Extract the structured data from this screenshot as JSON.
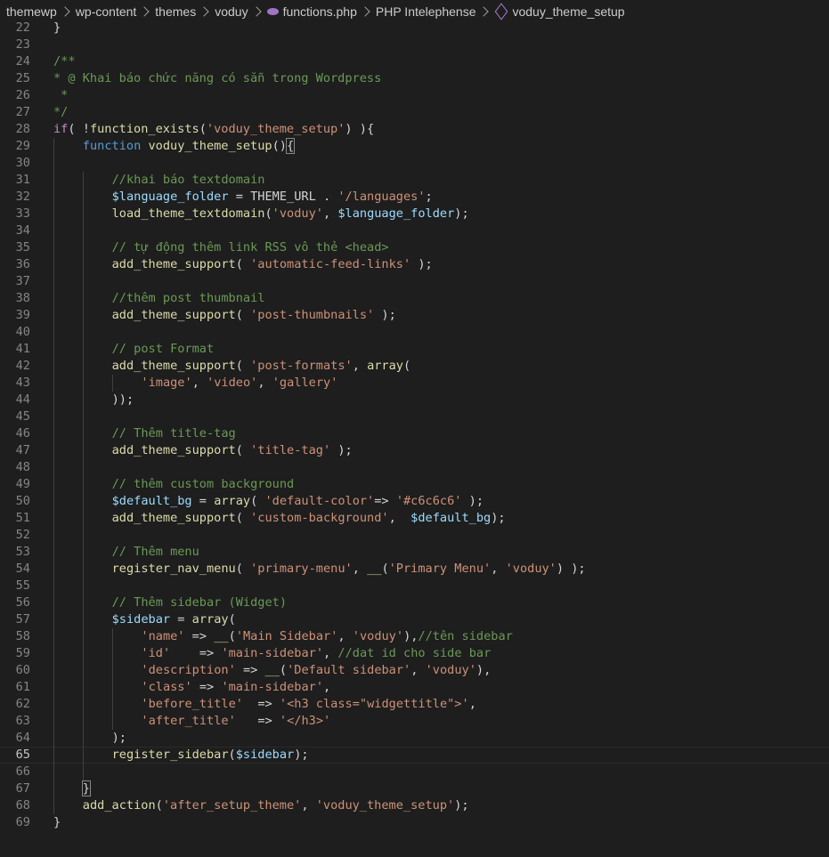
{
  "breadcrumb": {
    "items": [
      "themewp",
      "wp-content",
      "themes",
      "voduy",
      "functions.php",
      "PHP Intelephense",
      "voduy_theme_setup"
    ]
  },
  "editor": {
    "current_line": 65,
    "lines": [
      {
        "n": 22,
        "i": 0,
        "t": [
          [
            "p",
            "}"
          ]
        ]
      },
      {
        "n": 23,
        "i": 0,
        "t": []
      },
      {
        "n": 24,
        "i": 0,
        "t": [
          [
            "c",
            "/**"
          ]
        ]
      },
      {
        "n": 25,
        "i": 0,
        "t": [
          [
            "c",
            "* @ Khai báo chức năng có sẵn trong Wordpress"
          ]
        ]
      },
      {
        "n": 26,
        "i": 0,
        "t": [
          [
            "c",
            " *"
          ]
        ]
      },
      {
        "n": 27,
        "i": 0,
        "t": [
          [
            "c",
            "*/"
          ]
        ]
      },
      {
        "n": 28,
        "i": 0,
        "t": [
          [
            "k",
            "if"
          ],
          [
            "p",
            "( !"
          ],
          [
            "f",
            "function_exists"
          ],
          [
            "p",
            "("
          ],
          [
            "s",
            "'voduy_theme_setup'"
          ],
          [
            "p",
            ") ){"
          ]
        ]
      },
      {
        "n": 29,
        "i": 1,
        "t": [
          [
            "kb",
            "function"
          ],
          [
            "p",
            " "
          ],
          [
            "f",
            "voduy_theme_setup"
          ],
          [
            "p",
            "()"
          ],
          [
            "cur",
            "{"
          ]
        ]
      },
      {
        "n": 30,
        "i": 1,
        "t": []
      },
      {
        "n": 31,
        "i": 2,
        "t": [
          [
            "c",
            "//khai báo textdomain"
          ]
        ]
      },
      {
        "n": 32,
        "i": 2,
        "t": [
          [
            "v",
            "$language_folder"
          ],
          [
            "p",
            " = THEME_URL . "
          ],
          [
            "s",
            "'/languages'"
          ],
          [
            "p",
            ";"
          ]
        ]
      },
      {
        "n": 33,
        "i": 2,
        "t": [
          [
            "f",
            "load_theme_textdomain"
          ],
          [
            "p",
            "("
          ],
          [
            "s",
            "'voduy'"
          ],
          [
            "p",
            ", "
          ],
          [
            "v",
            "$language_folder"
          ],
          [
            "p",
            ");"
          ]
        ]
      },
      {
        "n": 34,
        "i": 2,
        "t": []
      },
      {
        "n": 35,
        "i": 2,
        "t": [
          [
            "c",
            "// tự động thêm link RSS vô thẻ <head>"
          ]
        ]
      },
      {
        "n": 36,
        "i": 2,
        "t": [
          [
            "f",
            "add_theme_support"
          ],
          [
            "p",
            "( "
          ],
          [
            "s",
            "'automatic-feed-links'"
          ],
          [
            "p",
            " );"
          ]
        ]
      },
      {
        "n": 37,
        "i": 2,
        "t": []
      },
      {
        "n": 38,
        "i": 2,
        "t": [
          [
            "c",
            "//thêm post thumbnail"
          ]
        ]
      },
      {
        "n": 39,
        "i": 2,
        "t": [
          [
            "f",
            "add_theme_support"
          ],
          [
            "p",
            "( "
          ],
          [
            "s",
            "'post-thumbnails'"
          ],
          [
            "p",
            " );"
          ]
        ]
      },
      {
        "n": 40,
        "i": 2,
        "t": []
      },
      {
        "n": 41,
        "i": 2,
        "t": [
          [
            "c",
            "// post Format"
          ]
        ]
      },
      {
        "n": 42,
        "i": 2,
        "t": [
          [
            "f",
            "add_theme_support"
          ],
          [
            "p",
            "( "
          ],
          [
            "s",
            "'post-formats'"
          ],
          [
            "p",
            ", "
          ],
          [
            "f",
            "array"
          ],
          [
            "p",
            "("
          ]
        ]
      },
      {
        "n": 43,
        "i": 3,
        "t": [
          [
            "s",
            "'image'"
          ],
          [
            "p",
            ", "
          ],
          [
            "s",
            "'video'"
          ],
          [
            "p",
            ", "
          ],
          [
            "s",
            "'gallery'"
          ]
        ]
      },
      {
        "n": 44,
        "i": 2,
        "t": [
          [
            "p",
            "));"
          ]
        ]
      },
      {
        "n": 45,
        "i": 2,
        "t": []
      },
      {
        "n": 46,
        "i": 2,
        "t": [
          [
            "c",
            "// Thêm title-tag"
          ]
        ]
      },
      {
        "n": 47,
        "i": 2,
        "t": [
          [
            "f",
            "add_theme_support"
          ],
          [
            "p",
            "( "
          ],
          [
            "s",
            "'title-tag'"
          ],
          [
            "p",
            " );"
          ]
        ]
      },
      {
        "n": 48,
        "i": 2,
        "t": []
      },
      {
        "n": 49,
        "i": 2,
        "t": [
          [
            "c",
            "// thêm custom background"
          ]
        ]
      },
      {
        "n": 50,
        "i": 2,
        "t": [
          [
            "v",
            "$default_bg"
          ],
          [
            "p",
            " = "
          ],
          [
            "f",
            "array"
          ],
          [
            "p",
            "( "
          ],
          [
            "s",
            "'default-color'"
          ],
          [
            "p",
            "=> "
          ],
          [
            "s",
            "'#c6c6c6'"
          ],
          [
            "p",
            " );"
          ]
        ]
      },
      {
        "n": 51,
        "i": 2,
        "t": [
          [
            "f",
            "add_theme_support"
          ],
          [
            "p",
            "( "
          ],
          [
            "s",
            "'custom-background'"
          ],
          [
            "p",
            ",  "
          ],
          [
            "v",
            "$default_bg"
          ],
          [
            "p",
            ");"
          ]
        ]
      },
      {
        "n": 52,
        "i": 2,
        "t": []
      },
      {
        "n": 53,
        "i": 2,
        "t": [
          [
            "c",
            "// Thêm menu"
          ]
        ]
      },
      {
        "n": 54,
        "i": 2,
        "t": [
          [
            "f",
            "register_nav_menu"
          ],
          [
            "p",
            "( "
          ],
          [
            "s",
            "'primary-menu'"
          ],
          [
            "p",
            ", "
          ],
          [
            "f",
            "__"
          ],
          [
            "p",
            "("
          ],
          [
            "s",
            "'Primary Menu'"
          ],
          [
            "p",
            ", "
          ],
          [
            "s",
            "'voduy'"
          ],
          [
            "p",
            ") );"
          ]
        ]
      },
      {
        "n": 55,
        "i": 2,
        "t": []
      },
      {
        "n": 56,
        "i": 2,
        "t": [
          [
            "c",
            "// Thêm sidebar (Widget)"
          ]
        ]
      },
      {
        "n": 57,
        "i": 2,
        "t": [
          [
            "v",
            "$sidebar"
          ],
          [
            "p",
            " = "
          ],
          [
            "f",
            "array"
          ],
          [
            "p",
            "("
          ]
        ]
      },
      {
        "n": 58,
        "i": 3,
        "t": [
          [
            "s",
            "'name'"
          ],
          [
            "p",
            " => "
          ],
          [
            "f",
            "__"
          ],
          [
            "p",
            "("
          ],
          [
            "s",
            "'Main Sidebar'"
          ],
          [
            "p",
            ", "
          ],
          [
            "s",
            "'voduy'"
          ],
          [
            "p",
            "),"
          ],
          [
            "c",
            "//tên sidebar"
          ]
        ]
      },
      {
        "n": 59,
        "i": 3,
        "t": [
          [
            "s",
            "'id'"
          ],
          [
            "p",
            "    => "
          ],
          [
            "s",
            "'main-sidebar'"
          ],
          [
            "p",
            ", "
          ],
          [
            "c",
            "//dat id cho side bar"
          ]
        ]
      },
      {
        "n": 60,
        "i": 3,
        "t": [
          [
            "s",
            "'description'"
          ],
          [
            "p",
            " => "
          ],
          [
            "f",
            "__"
          ],
          [
            "p",
            "("
          ],
          [
            "s",
            "'Default sidebar'"
          ],
          [
            "p",
            ", "
          ],
          [
            "s",
            "'voduy'"
          ],
          [
            "p",
            "),"
          ]
        ]
      },
      {
        "n": 61,
        "i": 3,
        "t": [
          [
            "s",
            "'class'"
          ],
          [
            "p",
            " => "
          ],
          [
            "s",
            "'main-sidebar'"
          ],
          [
            "p",
            ","
          ]
        ]
      },
      {
        "n": 62,
        "i": 3,
        "t": [
          [
            "s",
            "'before_title'"
          ],
          [
            "p",
            "  => "
          ],
          [
            "s",
            "'<h3 class=\"widgettitle\">'"
          ],
          [
            "p",
            ","
          ]
        ]
      },
      {
        "n": 63,
        "i": 3,
        "t": [
          [
            "s",
            "'after_title'"
          ],
          [
            "p",
            "   => "
          ],
          [
            "s",
            "'</h3>'"
          ]
        ]
      },
      {
        "n": 64,
        "i": 2,
        "t": [
          [
            "p",
            ");"
          ]
        ]
      },
      {
        "n": 65,
        "i": 2,
        "t": [
          [
            "f",
            "register_sidebar"
          ],
          [
            "p",
            "("
          ],
          [
            "v",
            "$sidebar"
          ],
          [
            "p",
            ");"
          ]
        ]
      },
      {
        "n": 66,
        "i": 2,
        "t": []
      },
      {
        "n": 67,
        "i": 1,
        "t": [
          [
            "cur",
            "}"
          ]
        ]
      },
      {
        "n": 68,
        "i": 1,
        "t": [
          [
            "f",
            "add_action"
          ],
          [
            "p",
            "("
          ],
          [
            "s",
            "'after_setup_theme'"
          ],
          [
            "p",
            ", "
          ],
          [
            "s",
            "'voduy_theme_setup'"
          ],
          [
            "p",
            ");"
          ]
        ]
      },
      {
        "n": 69,
        "i": 0,
        "t": [
          [
            "p",
            "}"
          ]
        ]
      }
    ]
  }
}
